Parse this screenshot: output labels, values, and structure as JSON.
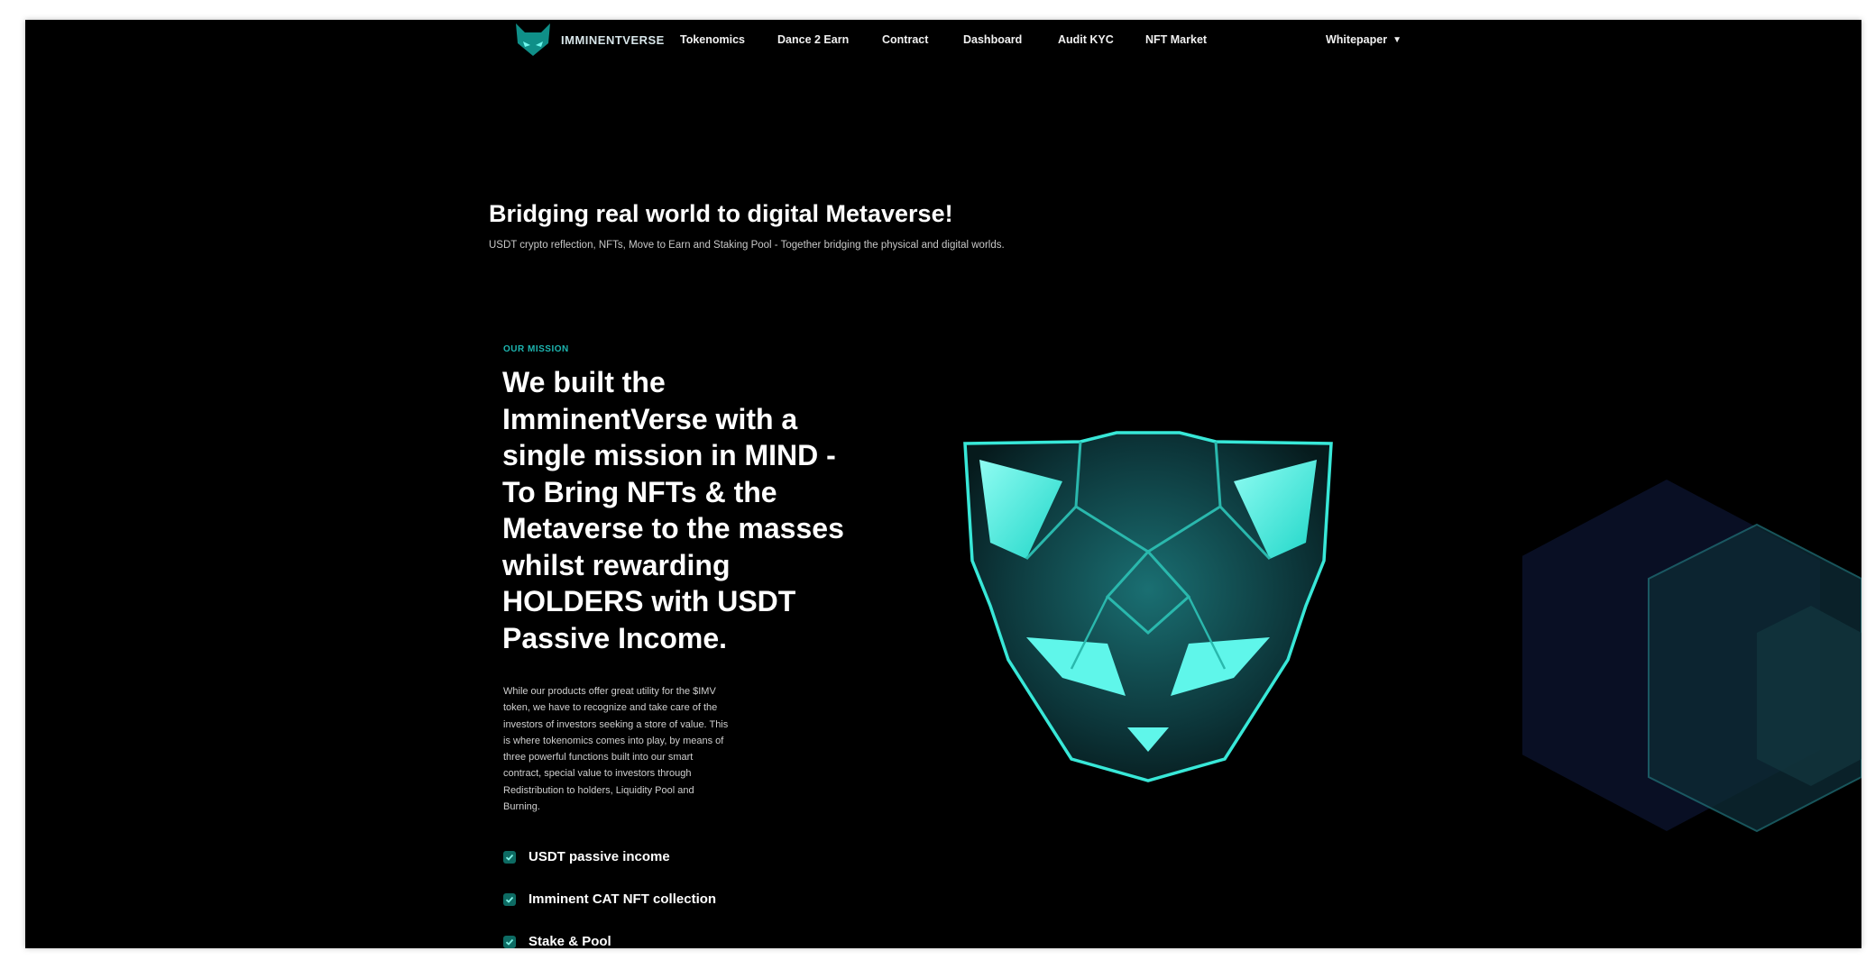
{
  "nav": {
    "logo_text": "IMMINENTVERSE",
    "items": [
      "Tokenomics",
      "Dance 2 Earn",
      "Contract",
      "Dashboard",
      "Audit KYC",
      "NFT Market"
    ],
    "whitepaper": "Whitepaper"
  },
  "hero": {
    "title": "Bridging real world to digital Metaverse!",
    "subtitle": "USDT crypto reflection, NFTs, Move to Earn and Staking Pool - Together bridging the physical and digital worlds."
  },
  "mission": {
    "label": "OUR MISSION",
    "heading_lines": [
      "We built the",
      "ImminentVerse with a",
      "single mission in MIND -",
      "To Bring NFTs & the",
      "Metaverse to the masses",
      "whilst rewarding",
      "HOLDERS with USDT",
      "Passive Income."
    ],
    "body_lines": [
      "While our products offer great utility for the $IMV",
      "token, we have to recognize and take care of the",
      "investors of investors seeking a store of value. This",
      "is where tokenomics comes into play, by means of",
      "three powerful functions built into our smart",
      "contract, special value to investors through",
      "Redistribution to holders, Liquidity Pool and",
      "Burning."
    ],
    "features": [
      "USDT passive income",
      "Imminent CAT NFT collection",
      "Stake & Pool"
    ]
  },
  "icons": {
    "logo": "cat-head-logo-icon",
    "dropdown": "chevron-down-icon",
    "check": "check-icon",
    "mascot": "cat-mask-illustration"
  },
  "colors": {
    "background": "#000000",
    "accent": "#2ee6d8",
    "accent_dark": "#0d6b63",
    "text": "#ffffff",
    "muted": "#c8c8c8"
  }
}
